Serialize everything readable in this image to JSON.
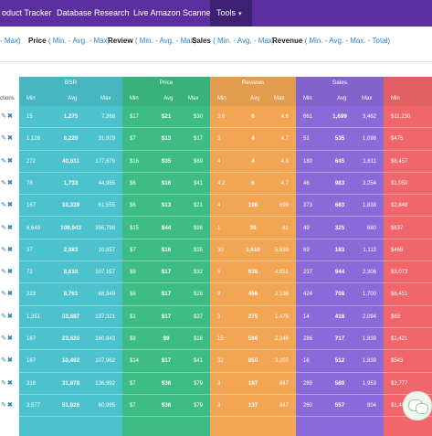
{
  "nav": {
    "items": [
      {
        "label": "oduct Tracker",
        "active": false
      },
      {
        "label": "Database Research",
        "active": false
      },
      {
        "label": "Live Amazon Scanner",
        "active": false
      },
      {
        "label": "Tools",
        "active": true
      }
    ],
    "caret_icon": "caret-down-icon"
  },
  "filters": [
    {
      "label": "",
      "options": "- Max)"
    },
    {
      "label": "Price",
      "options": "( Min. - Avg. - Max)"
    },
    {
      "label": "Review",
      "options": "( Min. - Avg. - Max)"
    },
    {
      "label": "Sales",
      "options": "( Min. - Avg. - Max)"
    },
    {
      "label": "Revenue",
      "options": "( Min. - Avg. - Max. - Total)"
    }
  ],
  "table": {
    "actions_label": "ctions",
    "groups": [
      {
        "label": "BSR",
        "color": "#4bc2cd"
      },
      {
        "label": "Price",
        "color": "#3dbd85"
      },
      {
        "label": "Reviews",
        "color": "#f2a553"
      },
      {
        "label": "Sales",
        "color": "#8a6ad8"
      },
      {
        "label": "",
        "color": "#f0666a"
      }
    ],
    "subheaders": {
      "min": "Min",
      "avg": "Avg",
      "max": "Max"
    },
    "rows": [
      {
        "bsr": [
          "15",
          "1,275",
          "7,368"
        ],
        "price": [
          "$17",
          "$21",
          "$30"
        ],
        "reviews": [
          "3.6",
          "6",
          "4.6"
        ],
        "sales": [
          "661",
          "1,699",
          "3,462"
        ],
        "revenue": "$11,230"
      },
      {
        "bsr": [
          "1,126",
          "8,229",
          "31,929"
        ],
        "price": [
          "$7",
          "$13",
          "$17"
        ],
        "reviews": [
          "3",
          "4",
          "4.7"
        ],
        "sales": [
          "51",
          "535",
          "1,098"
        ],
        "revenue": "$475"
      },
      {
        "bsr": [
          "272",
          "40,611",
          "177,676"
        ],
        "price": [
          "$16",
          "$35",
          "$60"
        ],
        "reviews": [
          "4",
          "4",
          "4.8"
        ],
        "sales": [
          "180",
          "645",
          "1,611"
        ],
        "revenue": "$6,457"
      },
      {
        "bsr": [
          "78",
          "1,733",
          "44,965"
        ],
        "price": [
          "$6",
          "$16",
          "$41"
        ],
        "reviews": [
          "4.2",
          "6",
          "4.7"
        ],
        "sales": [
          "46",
          "983",
          "3,254"
        ],
        "revenue": "$1,050"
      },
      {
        "bsr": [
          "167",
          "10,339",
          "61,555"
        ],
        "price": [
          "$6",
          "$13",
          "$21"
        ],
        "reviews": [
          "4",
          "108",
          "699"
        ],
        "sales": [
          "373",
          "683",
          "1,838"
        ],
        "revenue": "$2,848"
      },
      {
        "bsr": [
          "6,649",
          "108,943",
          "356,798"
        ],
        "price": [
          "$15",
          "$44",
          "$96"
        ],
        "reviews": [
          "1",
          "30",
          "81"
        ],
        "sales": [
          "49",
          "325",
          "680"
        ],
        "revenue": "$637"
      },
      {
        "bsr": [
          "37",
          "2,983",
          "10,857"
        ],
        "price": [
          "$7",
          "$16",
          "$35"
        ],
        "reviews": [
          "30",
          "1,610",
          "5,639"
        ],
        "sales": [
          "69",
          "183",
          "1,113"
        ],
        "revenue": "$466"
      },
      {
        "bsr": [
          "72",
          "8,618",
          "107,157"
        ],
        "price": [
          "$9",
          "$17",
          "$32"
        ],
        "reviews": [
          "5",
          "638",
          "4,651"
        ],
        "sales": [
          "237",
          "944",
          "2,306"
        ],
        "revenue": "$3,073"
      },
      {
        "bsr": [
          "223",
          "8,761",
          "68,949"
        ],
        "price": [
          "$6",
          "$17",
          "$26"
        ],
        "reviews": [
          "9",
          "466",
          "2,198"
        ],
        "sales": [
          "424",
          "708",
          "1,700"
        ],
        "revenue": "$6,451"
      },
      {
        "bsr": [
          "1,351",
          "33,687",
          "137,321"
        ],
        "price": [
          "$1",
          "$17",
          "$37"
        ],
        "reviews": [
          "3",
          "275",
          "1,476"
        ],
        "sales": [
          "14",
          "418",
          "2,094"
        ],
        "revenue": "$63"
      },
      {
        "bsr": [
          "167",
          "23,620",
          "160,843"
        ],
        "price": [
          "$8",
          "$9",
          "$16"
        ],
        "reviews": [
          "15",
          "596",
          "2,346"
        ],
        "sales": [
          "286",
          "717",
          "1,838"
        ],
        "revenue": "$1,421"
      },
      {
        "bsr": [
          "167",
          "10,402",
          "107,962"
        ],
        "price": [
          "$14",
          "$17",
          "$41"
        ],
        "reviews": [
          "32",
          "850",
          "3,207"
        ],
        "sales": [
          "16",
          "512",
          "1,838"
        ],
        "revenue": "$543"
      },
      {
        "bsr": [
          "318",
          "31,678",
          "136,992"
        ],
        "price": [
          "$7",
          "$36",
          "$79"
        ],
        "reviews": [
          "3",
          "197",
          "847"
        ],
        "sales": [
          "289",
          "589",
          "1,953"
        ],
        "revenue": "$3,777"
      },
      {
        "bsr": [
          "3,577",
          "51,926",
          "60,995"
        ],
        "price": [
          "$7",
          "$36",
          "$79"
        ],
        "reviews": [
          "3",
          "137",
          "647"
        ],
        "sales": [
          "260",
          "557",
          "804"
        ],
        "revenue": "$1,407"
      }
    ]
  },
  "icons": {
    "edit": "edit-icon",
    "delete": "delete-icon",
    "chat": "chat-bubble-icon"
  }
}
